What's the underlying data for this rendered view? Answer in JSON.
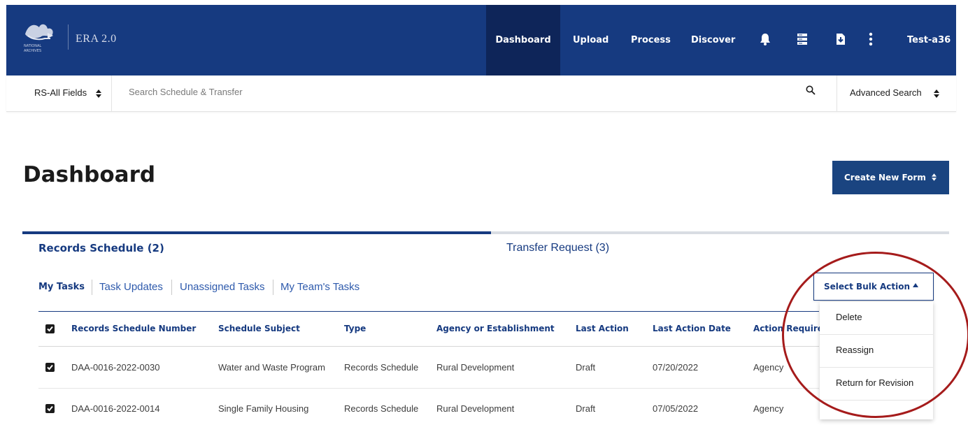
{
  "header": {
    "app_title": "ERA 2.0",
    "logo_text": "NATIONAL ARCHIVES",
    "nav": [
      {
        "label": "Dashboard",
        "active": true
      },
      {
        "label": "Upload"
      },
      {
        "label": "Process"
      },
      {
        "label": "Discover"
      }
    ],
    "icons": [
      "bell-icon",
      "server-icon",
      "download-file-icon",
      "more-vertical-icon"
    ],
    "user": "Test-a36",
    "colors": {
      "nav_bg": "#163a80",
      "nav_active_bg": "#0e2559"
    }
  },
  "search": {
    "scope": "RS-All Fields",
    "placeholder": "Search Schedule & Transfer",
    "value": "",
    "advanced": "Advanced Search"
  },
  "page": {
    "title": "Dashboard",
    "create_button": "Create New Form"
  },
  "main_tabs": [
    {
      "label": "Records Schedule (2)",
      "active": true
    },
    {
      "label": "Transfer Request (3)"
    }
  ],
  "sub_tabs": [
    {
      "label": "My Tasks",
      "active": true
    },
    {
      "label": "Task Updates"
    },
    {
      "label": "Unassigned Tasks"
    },
    {
      "label": "My Team's Tasks"
    }
  ],
  "bulk_action": {
    "label": "Select Bulk Action",
    "menu": [
      "Delete",
      "Reassign",
      "Return for Revision"
    ]
  },
  "table": {
    "columns": [
      "Records Schedule Number",
      "Schedule Subject",
      "Type",
      "Agency or Establishment",
      "Last Action",
      "Last Action Date",
      "Action Required"
    ],
    "select_all_checked": true,
    "rows": [
      {
        "checked": true,
        "cells": [
          "DAA-0016-2022-0030",
          "Water and Waste Program",
          "Records Schedule",
          "Rural Development",
          "Draft",
          "07/20/2022",
          "Agency"
        ]
      },
      {
        "checked": true,
        "cells": [
          "DAA-0016-2022-0014",
          "Single Family Housing",
          "Records Schedule",
          "Rural Development",
          "Draft",
          "07/05/2022",
          "Agency"
        ]
      }
    ],
    "row_icons": [
      "eye-icon",
      "more-vertical-icon"
    ]
  },
  "annotation": {
    "color": "#a51b1b"
  }
}
